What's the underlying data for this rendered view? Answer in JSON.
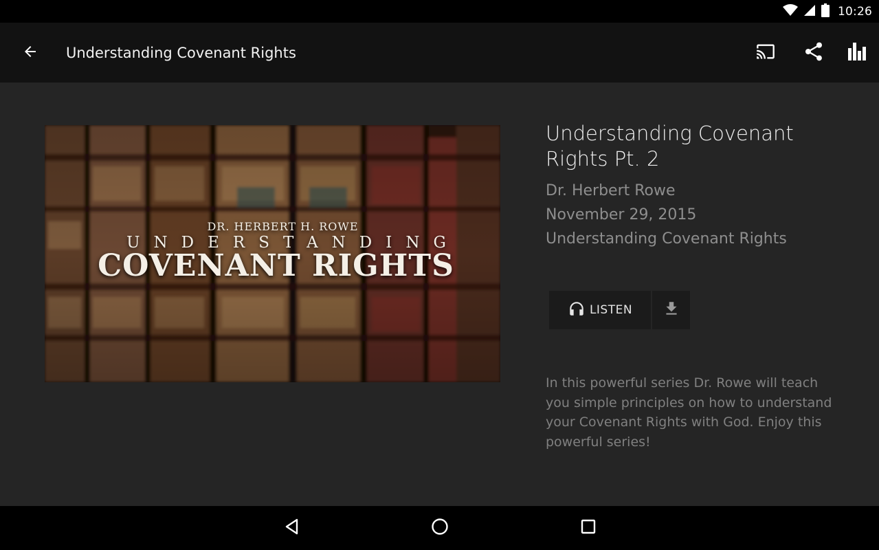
{
  "status_bar": {
    "time": "10:26"
  },
  "app_bar": {
    "title": "Understanding Covenant Rights",
    "icons": [
      "back-arrow-icon",
      "cast-icon",
      "share-icon",
      "bar-chart-icon"
    ]
  },
  "artwork": {
    "author": "DR. HERBERT H. ROWE",
    "line1": "UNDERSTANDING",
    "line2": "COVENANT RIGHTS"
  },
  "episode": {
    "title": "Understanding Covenant Rights Pt. 2",
    "speaker": "Dr. Herbert Rowe",
    "date": "November 29, 2015",
    "series": "Understanding Covenant Rights",
    "listen_label": "LISTEN",
    "description": "In this powerful series Dr. Rowe will teach you simple principles on how to understand your Covenant Rights with God. Enjoy this powerful series!"
  },
  "colors": {
    "background": "#252525",
    "app_bar": "#121212",
    "button_bg": "#1b1b1b",
    "meta_text": "#8e8e8e"
  }
}
